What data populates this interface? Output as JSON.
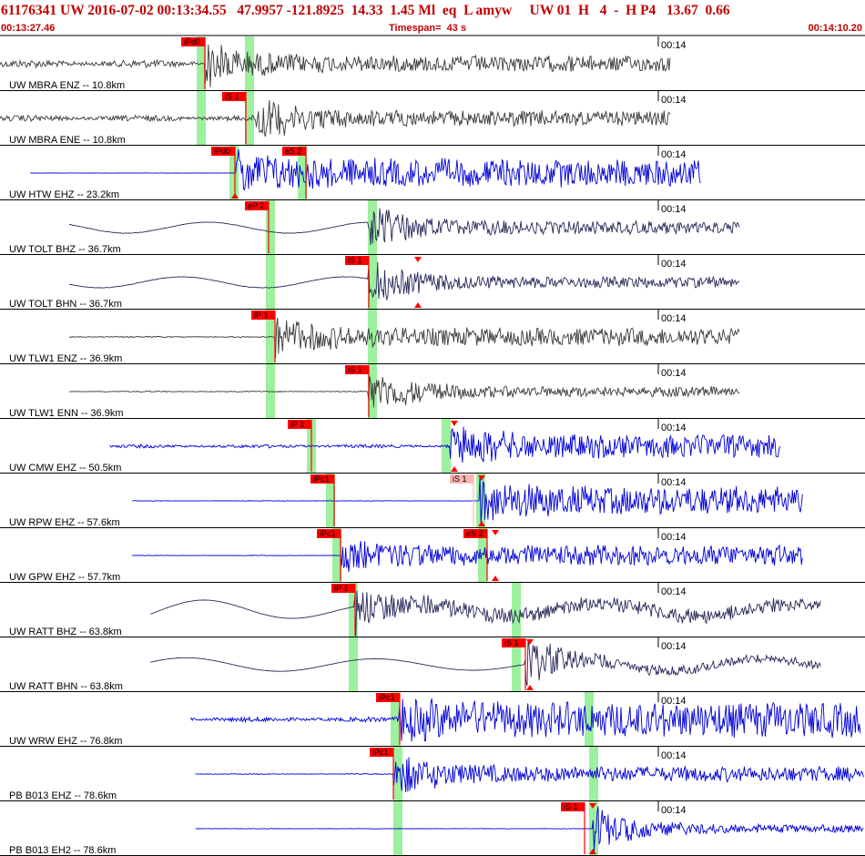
{
  "header": {
    "title": "61176341 UW 2016-07-02 00:13:34.55   47.9957 -121.8925  14.33  1.45 Ml  eq  L amyw     UW 01  H   4  -  H P4   13.67  0.66",
    "start_time": "00:13:27.46",
    "timespan": "Timespan=  43 s",
    "end_time": "00:14:10.20"
  },
  "colors": {
    "accent": "#c00000",
    "trace_dark": "#3a3a3a",
    "trace_blue": "#0000d8",
    "trace_navy": "#28285a",
    "pick_red": "#ff0000",
    "pick_pink": "#ffb4b4",
    "window_green": "#9df09d"
  },
  "panels": [
    {
      "label": "UW MBRA ENZ -- 10.8km",
      "time_label": "00:14",
      "color": "dark",
      "trace": {
        "start": 0.0,
        "end": 0.775,
        "onset": 0.237,
        "pre": 0.7,
        "peak": 1.0,
        "post": 0.32
      },
      "picks": [
        {
          "label": "iPd0",
          "pos": 0.237,
          "style": "red"
        }
      ],
      "windows": [
        0.233,
        0.288
      ],
      "tri_top": [],
      "tri_bottom": []
    },
    {
      "label": "UW MBRA ENE -- 10.8km",
      "time_label": "00:14",
      "color": "dark",
      "trace": {
        "start": 0.0,
        "end": 0.775,
        "onset": 0.296,
        "pre": 0.55,
        "peak": 1.0,
        "post": 0.3
      },
      "picks": [
        {
          "label": "iS 1",
          "pos": 0.284,
          "style": "red"
        }
      ],
      "windows": [
        0.233,
        0.288
      ],
      "tri_top": [],
      "tri_bottom": []
    },
    {
      "label": "UW HTW EHZ -- 23.2km",
      "time_label": "00:14",
      "color": "blue",
      "trace": {
        "start": 0.035,
        "end": 0.81,
        "onset": 0.272,
        "pre": 0.04,
        "peak": 1.0,
        "post": 0.55
      },
      "picks": [
        {
          "label": "iPd0",
          "pos": 0.272,
          "style": "red"
        },
        {
          "label": "eS 2",
          "pos": 0.354,
          "style": "red"
        }
      ],
      "windows": [
        0.27,
        0.349
      ],
      "tri_top": [],
      "tri_bottom": [
        0.272
      ]
    },
    {
      "label": "UW TOLT BHZ -- 36.7km",
      "time_label": "00:14",
      "color": "navy",
      "trace": {
        "start": 0.08,
        "end": 0.855,
        "onset": 0.426,
        "pre": 0.1,
        "peak": 1.0,
        "post": 0.25
      },
      "picks": [
        {
          "label": "eP 2",
          "pos": 0.31,
          "style": "red"
        }
      ],
      "windows": [
        0.313,
        0.43
      ],
      "tri_top": [],
      "tri_bottom": []
    },
    {
      "label": "UW TOLT BHN -- 36.7km",
      "time_label": "00:14",
      "color": "navy",
      "trace": {
        "start": 0.08,
        "end": 0.855,
        "onset": 0.426,
        "pre": 0.12,
        "peak": 1.0,
        "post": 0.22
      },
      "picks": [
        {
          "label": "iS 1",
          "pos": 0.426,
          "style": "red"
        }
      ],
      "windows": [
        0.313,
        0.43
      ],
      "tri_top": [
        0.483
      ],
      "tri_bottom": [
        0.483
      ]
    },
    {
      "label": "UW TLW1 ENZ -- 36.9km",
      "time_label": "00:14",
      "color": "dark",
      "trace": {
        "start": 0.08,
        "end": 0.855,
        "onset": 0.318,
        "pre": 0.12,
        "peak": 0.9,
        "post": 0.35
      },
      "picks": [
        {
          "label": "iP 1",
          "pos": 0.318,
          "style": "red"
        }
      ],
      "windows": [
        0.313,
        0.43
      ],
      "tri_top": [],
      "tri_bottom": []
    },
    {
      "label": "UW TLW1 ENN -- 36.9km",
      "time_label": "00:14",
      "color": "dark",
      "trace": {
        "start": 0.08,
        "end": 0.855,
        "onset": 0.426,
        "pre": 0.1,
        "peak": 1.0,
        "post": 0.2
      },
      "picks": [
        {
          "label": "iS 1",
          "pos": 0.426,
          "style": "red"
        }
      ],
      "windows": [
        0.313,
        0.43
      ],
      "tri_top": [],
      "tri_bottom": []
    },
    {
      "label": "UW CMW EHZ -- 50.5km",
      "time_label": "00:14",
      "color": "blue",
      "trace": {
        "start": 0.127,
        "end": 0.902,
        "onset": 0.52,
        "pre": 0.32,
        "peak": 1.0,
        "post": 0.45
      },
      "picks": [
        {
          "label": "iP 1",
          "pos": 0.36,
          "style": "red"
        }
      ],
      "windows": [
        0.36,
        0.516
      ],
      "tri_top": [
        0.525
      ],
      "tri_bottom": [
        0.525
      ]
    },
    {
      "label": "UW RPW EHZ -- 57.6km",
      "time_label": "00:14",
      "color": "blue",
      "trace": {
        "start": 0.153,
        "end": 0.928,
        "onset": 0.554,
        "pre": 0.06,
        "peak": 1.0,
        "post": 0.55
      },
      "picks": [
        {
          "label": "iPc1",
          "pos": 0.386,
          "style": "red"
        },
        {
          "label": "iS 1",
          "pos": 0.547,
          "style": "pink"
        }
      ],
      "windows": [
        0.382,
        0.556
      ],
      "tri_top": [
        0.557
      ],
      "tri_bottom": [
        0.557
      ]
    },
    {
      "label": "UW GPW EHZ -- 57.7km",
      "time_label": "00:14",
      "color": "blue",
      "trace": {
        "start": 0.153,
        "end": 0.928,
        "onset": 0.394,
        "pre": 0.06,
        "peak": 0.8,
        "post": 0.4
      },
      "picks": [
        {
          "label": "iPc1",
          "pos": 0.394,
          "style": "red"
        },
        {
          "label": "eS 2",
          "pos": 0.563,
          "style": "red"
        }
      ],
      "windows": [
        0.389,
        0.558
      ],
      "tri_top": [
        0.573
      ],
      "tri_bottom": [
        0.573
      ]
    },
    {
      "label": "UW RATT BHZ -- 63.8km",
      "time_label": "00:14",
      "color": "navy",
      "trace": {
        "start": 0.174,
        "end": 0.949,
        "onset": 0.41,
        "pre": 0.05,
        "peak": 1.0,
        "post": 0.3
      },
      "picks": [
        {
          "label": "iP 1",
          "pos": 0.41,
          "style": "red"
        }
      ],
      "windows": [
        0.408,
        0.597
      ],
      "tri_top": [],
      "tri_bottom": []
    },
    {
      "label": "UW RATT BHN -- 63.8km",
      "time_label": "00:14",
      "color": "navy",
      "trace": {
        "start": 0.174,
        "end": 0.949,
        "onset": 0.607,
        "pre": 0.04,
        "peak": 1.0,
        "post": 0.18
      },
      "picks": [
        {
          "label": "iS 1",
          "pos": 0.607,
          "style": "red"
        }
      ],
      "windows": [
        0.408,
        0.597
      ],
      "tri_top": [
        0.613
      ],
      "tri_bottom": [
        0.613
      ]
    },
    {
      "label": "UW WRW EHZ -- 76.8km",
      "time_label": "00:14",
      "color": "blue",
      "trace": {
        "start": 0.22,
        "end": 0.995,
        "onset": 0.462,
        "pre": 0.45,
        "peak": 0.95,
        "post": 0.7
      },
      "picks": [
        {
          "label": "iPc1",
          "pos": 0.462,
          "style": "red"
        }
      ],
      "windows": [
        0.457,
        0.681
      ],
      "tri_top": [],
      "tri_bottom": []
    },
    {
      "label": "PB B013 EHZ -- 78.6km",
      "time_label": "00:14",
      "color": "blue",
      "trace": {
        "start": 0.226,
        "end": 0.999,
        "onset": 0.455,
        "pre": 0.08,
        "peak": 1.0,
        "post": 0.3
      },
      "picks": [
        {
          "label": "iPc1",
          "pos": 0.455,
          "style": "red"
        }
      ],
      "windows": [
        0.46,
        0.686
      ],
      "tri_top": [],
      "tri_bottom": []
    },
    {
      "label": "PB B013 EH2 -- 78.6km",
      "time_label": "00:14",
      "color": "blue",
      "trace": {
        "start": 0.226,
        "end": 0.999,
        "onset": 0.685,
        "pre": 0.05,
        "peak": 1.0,
        "post": 0.15
      },
      "picks": [
        {
          "label": "iS 1",
          "pos": 0.676,
          "style": "red"
        }
      ],
      "windows": [
        0.46,
        0.686
      ],
      "tri_top": [
        0.685
      ],
      "tri_bottom": [
        0.685
      ]
    }
  ]
}
